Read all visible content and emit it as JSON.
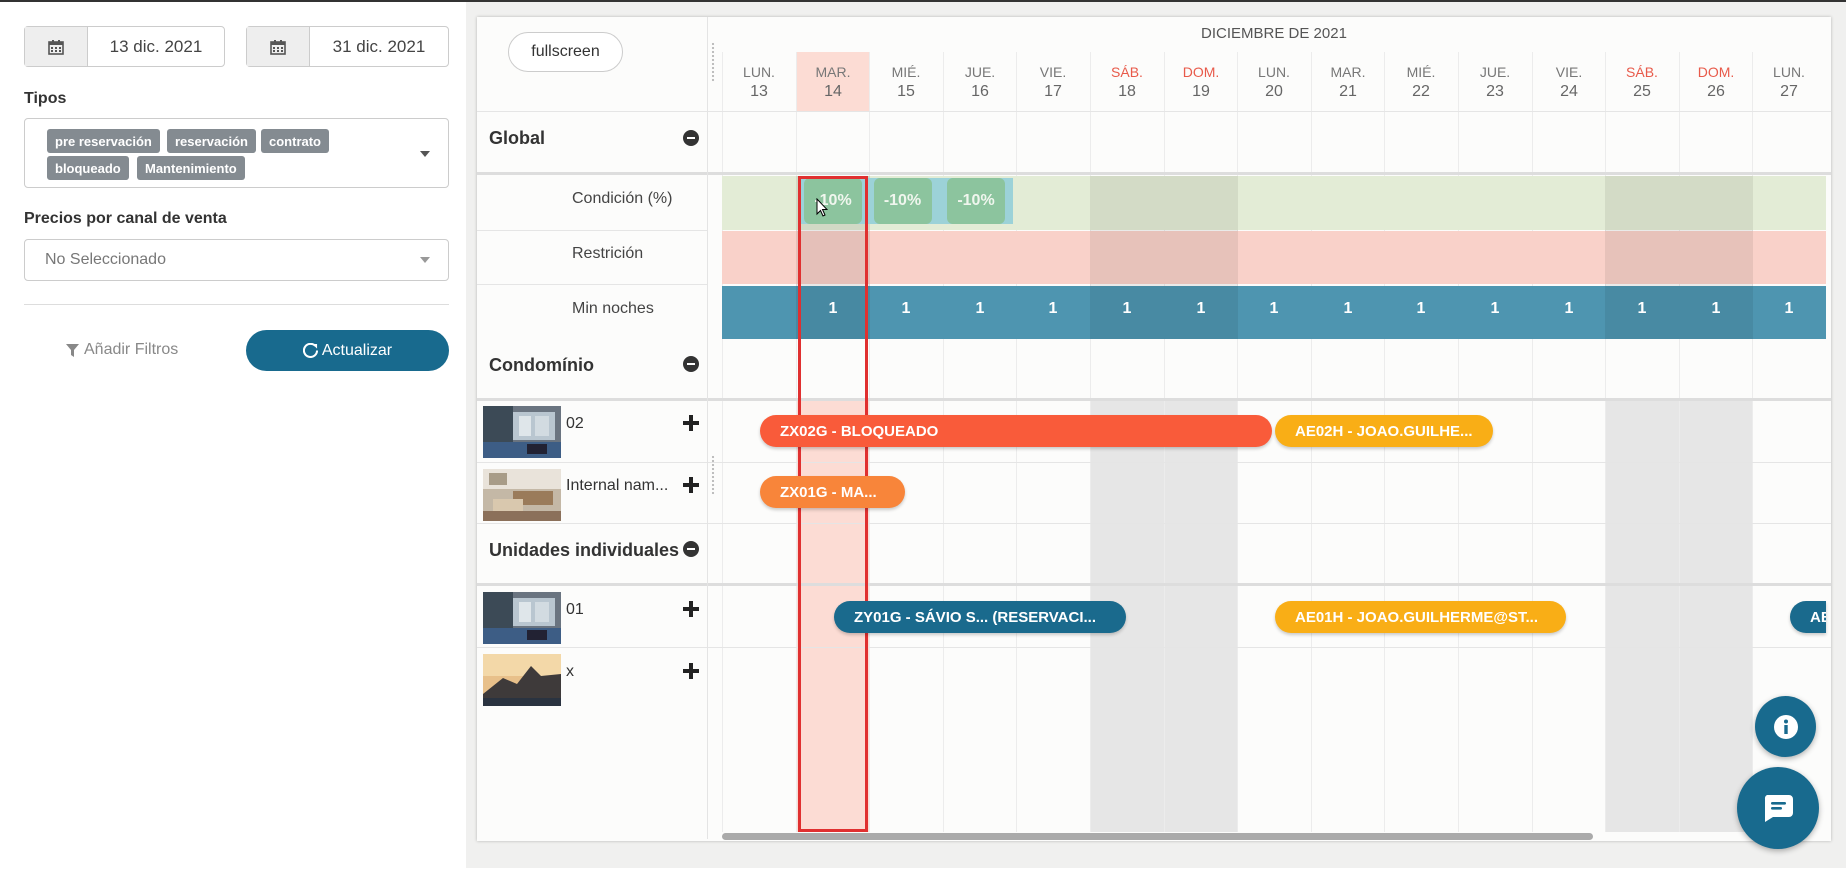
{
  "filters": {
    "date_from": "13 dic. 2021",
    "date_to": "31 dic. 2021",
    "tipos_label": "Tipos",
    "tipos_tags": [
      "pre reservación",
      "reservación",
      "contrato",
      "bloqueado",
      "Mantenimiento"
    ],
    "precios_label": "Precios por canal de venta",
    "precios_value": "No Seleccionado",
    "add_filters_label": "Añadir Filtros",
    "update_label": "Actualizar"
  },
  "calendar": {
    "fullscreen_label": "fullscreen",
    "month_label": "DICIEMBRE DE 2021",
    "days": [
      {
        "dow": "LUN.",
        "num": "13",
        "weekend": false,
        "today": false
      },
      {
        "dow": "MAR.",
        "num": "14",
        "weekend": false,
        "today": true
      },
      {
        "dow": "MIÉ.",
        "num": "15",
        "weekend": false,
        "today": false
      },
      {
        "dow": "JUE.",
        "num": "16",
        "weekend": false,
        "today": false
      },
      {
        "dow": "VIE.",
        "num": "17",
        "weekend": false,
        "today": false
      },
      {
        "dow": "SÁB.",
        "num": "18",
        "weekend": true,
        "today": false
      },
      {
        "dow": "DOM.",
        "num": "19",
        "weekend": true,
        "today": false
      },
      {
        "dow": "LUN.",
        "num": "20",
        "weekend": false,
        "today": false
      },
      {
        "dow": "MAR.",
        "num": "21",
        "weekend": false,
        "today": false
      },
      {
        "dow": "MIÉ.",
        "num": "22",
        "weekend": false,
        "today": false
      },
      {
        "dow": "JUE.",
        "num": "23",
        "weekend": false,
        "today": false
      },
      {
        "dow": "VIE.",
        "num": "24",
        "weekend": false,
        "today": false
      },
      {
        "dow": "SÁB.",
        "num": "25",
        "weekend": true,
        "today": false
      },
      {
        "dow": "DOM.",
        "num": "26",
        "weekend": true,
        "today": false
      },
      {
        "dow": "LUN.",
        "num": "27",
        "weekend": false,
        "today": false
      }
    ],
    "global": {
      "title": "Global",
      "condicion_label": "Condición (%)",
      "restriccion_label": "Restrición",
      "min_noches_label": "Min noches",
      "discounts": [
        "-10%",
        "-10%",
        "-10%"
      ],
      "min_noches_values": [
        "1",
        "1",
        "1",
        "1",
        "1",
        "1",
        "1",
        "1",
        "1",
        "1",
        "1",
        "1",
        "1",
        "1"
      ]
    },
    "condominio": {
      "title": "Condomínio",
      "units": [
        {
          "name": "02"
        },
        {
          "name": "Internal nam..."
        }
      ]
    },
    "individuales": {
      "title": "Unidades individuales",
      "units": [
        {
          "name": "01"
        },
        {
          "name": "x"
        }
      ]
    },
    "bookings": [
      {
        "label": "ZX02G - BLOQUEADO",
        "color": "#f95b3a"
      },
      {
        "label": "AE02H - JOAO.GUILHE...",
        "color": "#f9ae16"
      },
      {
        "label": "ZX01G - MA...",
        "color": "#f8853a"
      },
      {
        "label": "ZY01G - SÁVIO S... (RESERVACI...",
        "color": "#1a6a8d"
      },
      {
        "label": "AE01H - JOAO.GUILHERME@ST...",
        "color": "#f9ae16"
      },
      {
        "label": "AE",
        "color": "#1a6a8d"
      }
    ]
  }
}
